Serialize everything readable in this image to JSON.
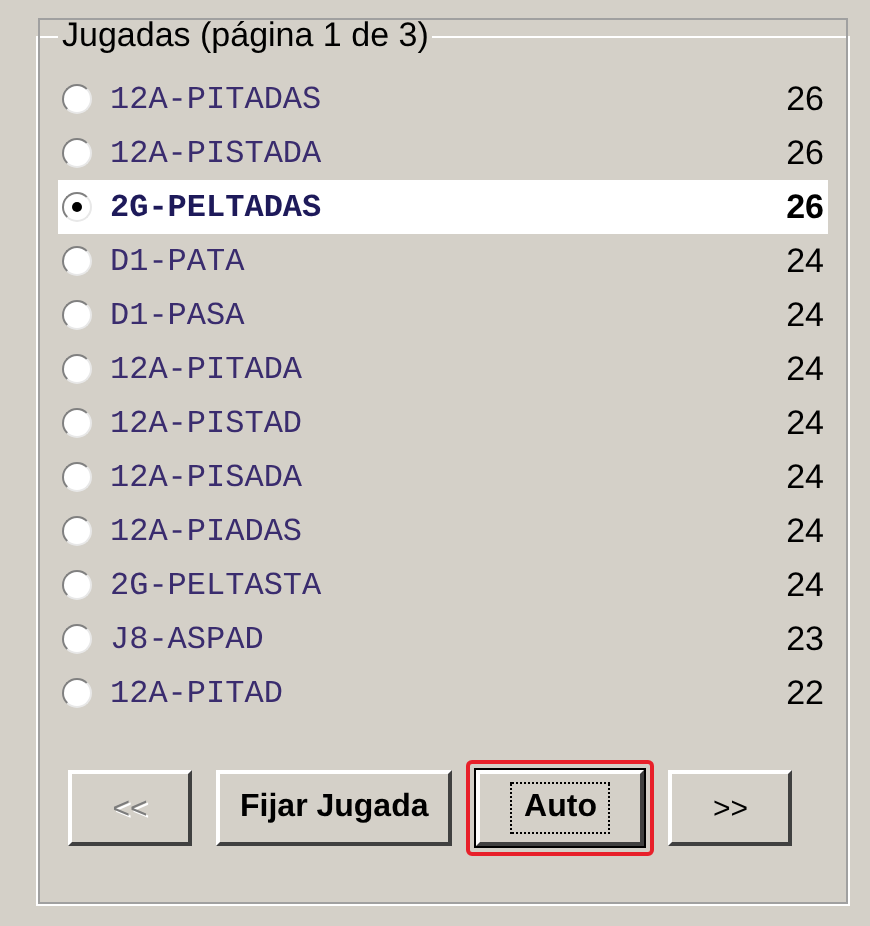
{
  "group": {
    "title": "Jugadas (página 1 de 3)"
  },
  "plays": [
    {
      "word": "12A-PITADAS",
      "score": "26",
      "selected": false
    },
    {
      "word": "12A-PISTADA",
      "score": "26",
      "selected": false
    },
    {
      "word": "2G-PELTADAS",
      "score": "26",
      "selected": true
    },
    {
      "word": "D1-PATA",
      "score": "24",
      "selected": false
    },
    {
      "word": "D1-PASA",
      "score": "24",
      "selected": false
    },
    {
      "word": "12A-PITADA",
      "score": "24",
      "selected": false
    },
    {
      "word": "12A-PISTAD",
      "score": "24",
      "selected": false
    },
    {
      "word": "12A-PISADA",
      "score": "24",
      "selected": false
    },
    {
      "word": "12A-PIADAS",
      "score": "24",
      "selected": false
    },
    {
      "word": "2G-PELTASTA",
      "score": "24",
      "selected": false
    },
    {
      "word": "J8-ASPAD",
      "score": "23",
      "selected": false
    },
    {
      "word": "12A-PITAD",
      "score": "22",
      "selected": false
    }
  ],
  "buttons": [
    {
      "label": "<<",
      "disabled": true,
      "focused": false,
      "highlighted": false
    },
    {
      "label": "Fijar Jugada",
      "disabled": false,
      "focused": false,
      "highlighted": false
    },
    {
      "label": "Auto",
      "disabled": false,
      "focused": true,
      "highlighted": true
    },
    {
      "label": ">>",
      "disabled": false,
      "focused": false,
      "highlighted": false
    }
  ]
}
